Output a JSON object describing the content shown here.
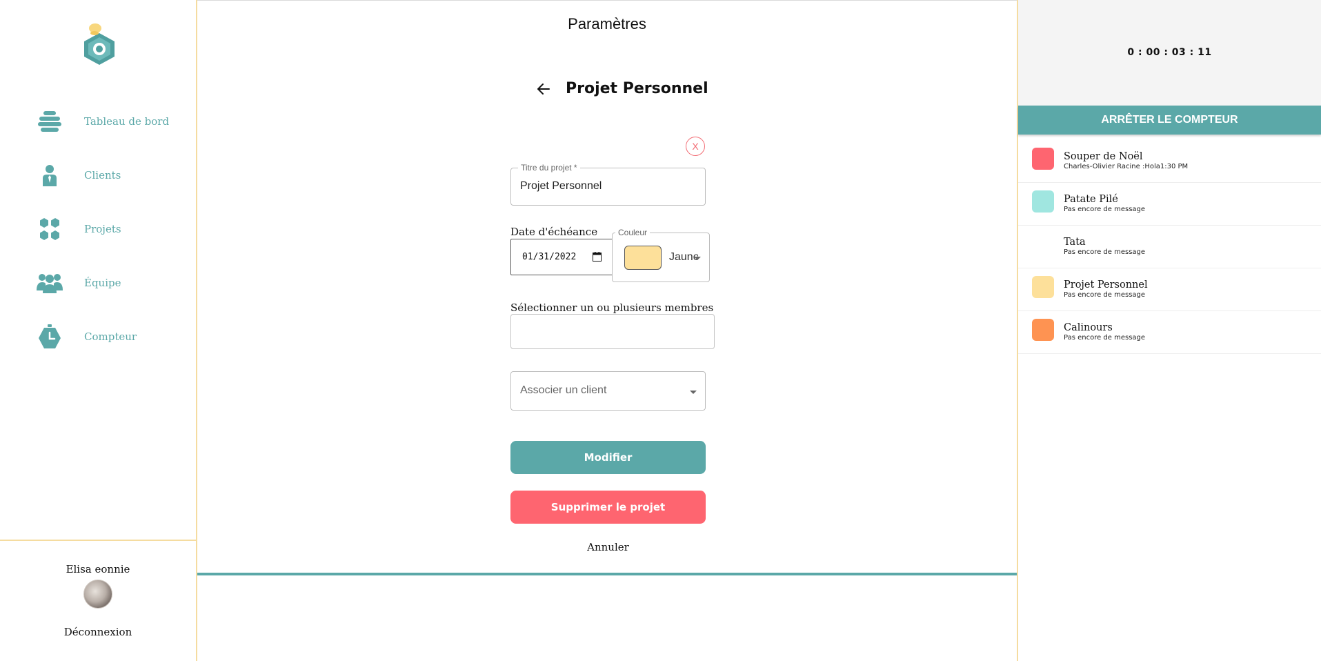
{
  "sidebar": {
    "nav": [
      {
        "label": "Tableau de bord",
        "icon": "hive-icon"
      },
      {
        "label": "Clients",
        "icon": "person-tie-icon"
      },
      {
        "label": "Projets",
        "icon": "hexagons-icon"
      },
      {
        "label": "Équipe",
        "icon": "team-icon"
      },
      {
        "label": "Compteur",
        "icon": "stopwatch-icon"
      }
    ],
    "user_name": "Elisa eonnie",
    "logout_label": "Déconnexion"
  },
  "main": {
    "page_title": "Paramètres",
    "project_title": "Projet Personnel",
    "close_label": "X",
    "form": {
      "title_label": "Titre du projet *",
      "title_value": "Projet Personnel",
      "due_date_label": "Date d'échéance",
      "due_date_value": "01/31/2022",
      "color_label": "Couleur",
      "color_value": "Jaune",
      "members_label": "Sélectionner un ou plusieurs membres",
      "client_placeholder": "Associer un client",
      "modify_label": "Modifier",
      "delete_label": "Supprimer le projet",
      "cancel_label": "Annuler"
    }
  },
  "right_panel": {
    "timer": "0 : 00 : 03 : 11",
    "stop_label": "ARRÊTER LE COMPTEUR",
    "projects": [
      {
        "name": "Souper de Noël",
        "message": "Charles-Olivier Racine :Hola1:30 PM",
        "color": "#fe6570"
      },
      {
        "name": "Patate Pilé",
        "message": "Pas encore de message",
        "color": "#a0e6e0"
      },
      {
        "name": "Tata",
        "message": "Pas encore de message",
        "color": "#ffffff"
      },
      {
        "name": "Projet Personnel",
        "message": "Pas encore de message",
        "color": "#fde09a"
      },
      {
        "name": "Calinours",
        "message": "Pas encore de message",
        "color": "#fe9352"
      }
    ]
  },
  "colors": {
    "accent": "#5ba8a8",
    "danger": "#fe6570",
    "border_yellow": "#f5dca0",
    "swatch_yellow": "#fde09a"
  }
}
